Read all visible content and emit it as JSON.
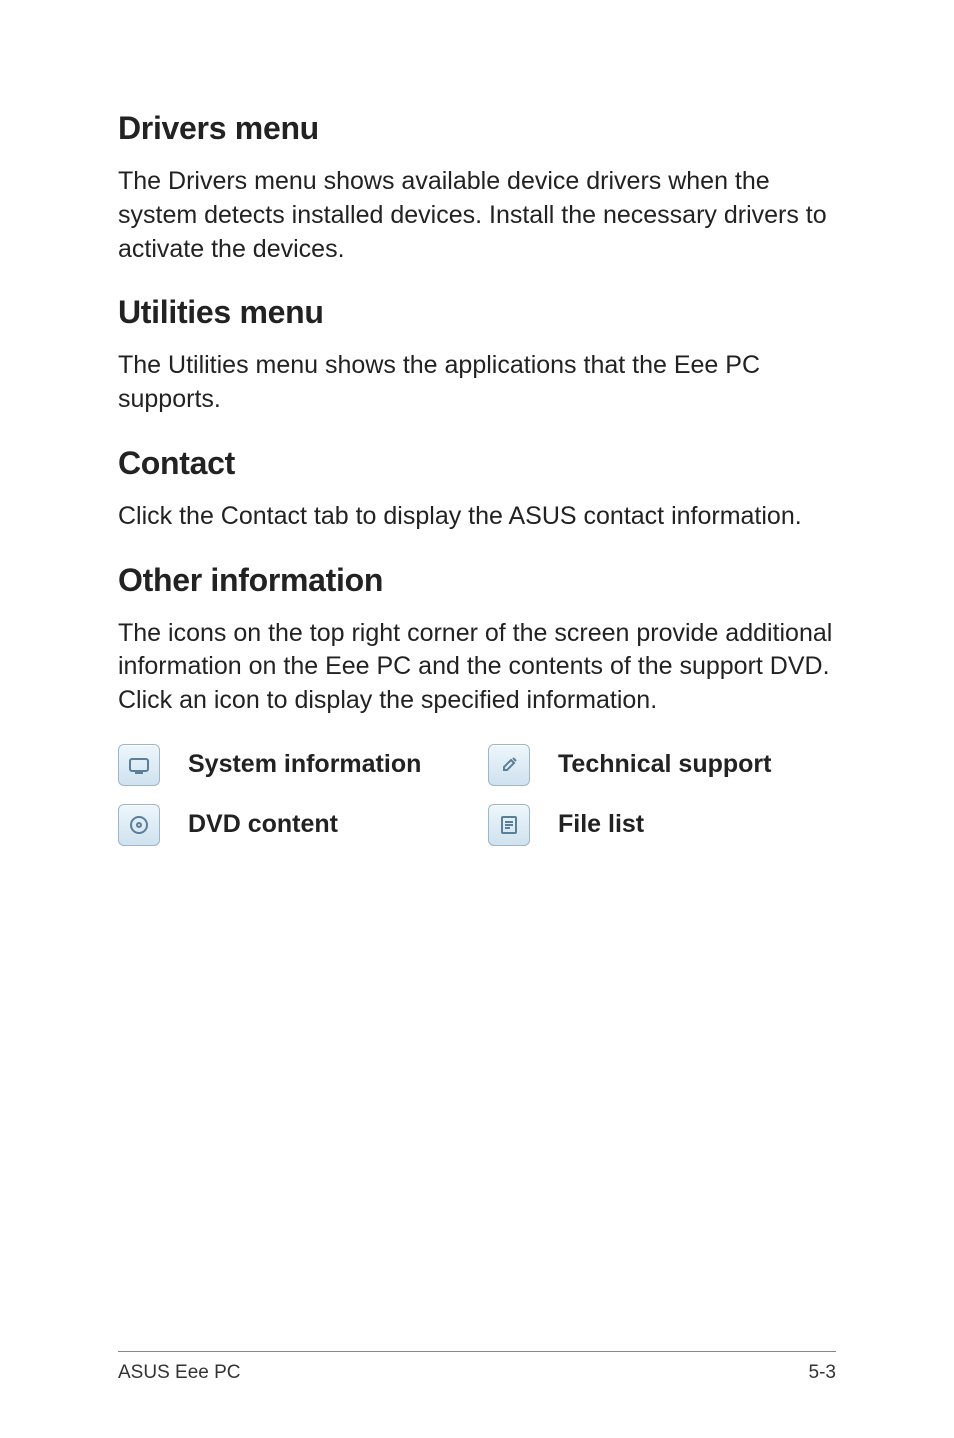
{
  "sections": {
    "drivers": {
      "heading": "Drivers menu",
      "body": "The Drivers menu shows available device drivers when the system detects installed devices. Install the necessary drivers to activate the devices."
    },
    "utilities": {
      "heading": "Utilities menu",
      "body": "The Utilities menu shows the applications that the Eee PC supports."
    },
    "contact": {
      "heading": "Contact",
      "body": "Click the Contact tab to display the ASUS contact information."
    },
    "other": {
      "heading": "Other information",
      "body": "The icons on the top right corner of the screen provide additional information on the Eee PC and the contents of the support DVD. Click an icon to display the specified information."
    }
  },
  "icons": {
    "system_info": {
      "label": "System information"
    },
    "tech_support": {
      "label": "Technical support"
    },
    "dvd_content": {
      "label": "DVD content"
    },
    "file_list": {
      "label": "File list"
    }
  },
  "footer": {
    "left": "ASUS Eee PC",
    "right": "5-3"
  }
}
